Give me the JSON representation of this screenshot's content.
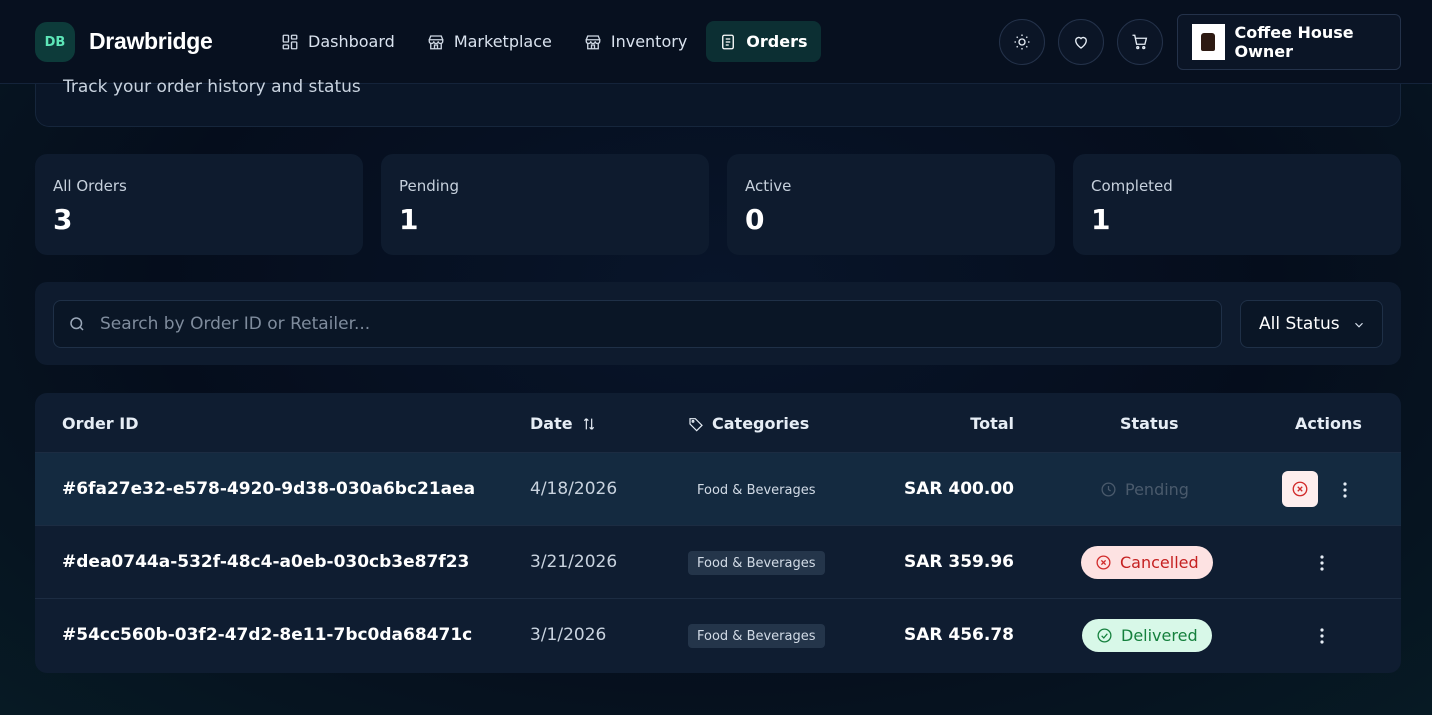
{
  "app": {
    "logo_initials": "DB",
    "brand": "Drawbridge"
  },
  "nav": [
    {
      "label": "Dashboard",
      "icon": "dashboard-grid-icon",
      "active": false
    },
    {
      "label": "Marketplace",
      "icon": "store-icon",
      "active": false
    },
    {
      "label": "Inventory",
      "icon": "store-icon",
      "active": false
    },
    {
      "label": "Orders",
      "icon": "document-list-icon",
      "active": true
    }
  ],
  "header_actions": {
    "theme_icon": "sun-icon",
    "favorites_icon": "heart-icon",
    "cart_icon": "cart-icon",
    "profile_name": "Coffee House Owner"
  },
  "page": {
    "subtitle": "Track your order history and status"
  },
  "stats": [
    {
      "label": "All Orders",
      "value": "3"
    },
    {
      "label": "Pending",
      "value": "1"
    },
    {
      "label": "Active",
      "value": "0"
    },
    {
      "label": "Completed",
      "value": "1"
    }
  ],
  "filters": {
    "search_placeholder": "Search by Order ID or Retailer...",
    "status_selected": "All Status"
  },
  "table": {
    "columns": {
      "order_id": "Order ID",
      "date": "Date",
      "categories": "Categories",
      "total": "Total",
      "status": "Status",
      "actions": "Actions"
    },
    "rows": [
      {
        "id": "#6fa27e32-e578-4920-9d38-030a6bc21aea",
        "date": "4/18/2026",
        "category": "Food & Beverages",
        "total": "SAR 400.00",
        "status": "Pending"
      },
      {
        "id": "#dea0744a-532f-48c4-a0eb-030cb3e87f23",
        "date": "3/21/2026",
        "category": "Food & Beverages",
        "total": "SAR 359.96",
        "status": "Cancelled"
      },
      {
        "id": "#54cc560b-03f2-47d2-8e11-7bc0da68471c",
        "date": "3/1/2026",
        "category": "Food & Beverages",
        "total": "SAR 456.78",
        "status": "Delivered"
      }
    ]
  },
  "colors": {
    "accent": "#5ee6b8",
    "cancelled": "#c52020",
    "delivered": "#15803d"
  }
}
